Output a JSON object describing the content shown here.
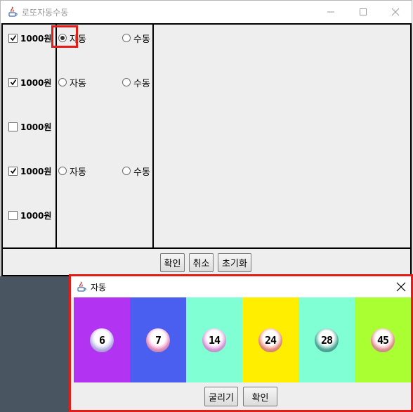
{
  "main_window": {
    "title": "로또자동수동",
    "rows": [
      {
        "checked": true,
        "amount": "1000원",
        "auto_label": "자동",
        "manual_label": "수동",
        "show_radios": true,
        "auto_selected": true
      },
      {
        "checked": true,
        "amount": "1000원",
        "auto_label": "자동",
        "manual_label": "수동",
        "show_radios": true,
        "auto_selected": false
      },
      {
        "checked": false,
        "amount": "1000원",
        "auto_label": "",
        "manual_label": "",
        "show_radios": false,
        "auto_selected": false
      },
      {
        "checked": true,
        "amount": "1000원",
        "auto_label": "자동",
        "manual_label": "수동",
        "show_radios": true,
        "auto_selected": false
      },
      {
        "checked": false,
        "amount": "1000원",
        "auto_label": "",
        "manual_label": "",
        "show_radios": false,
        "auto_selected": false
      }
    ],
    "buttons": {
      "confirm": "확인",
      "cancel": "취소",
      "reset": "초기화"
    }
  },
  "popup": {
    "title": "자동",
    "balls": [
      {
        "number": "6",
        "cell_color": "#b233f2",
        "ball_color": "#c8c0f8"
      },
      {
        "number": "7",
        "cell_color": "#4a5ff0",
        "ball_color": "#f4a0d0"
      },
      {
        "number": "14",
        "cell_color": "#80ffd4",
        "ball_color": "#e8a8e8"
      },
      {
        "number": "24",
        "cell_color": "#ffee00",
        "ball_color": "#f49a8a"
      },
      {
        "number": "28",
        "cell_color": "#80ffd4",
        "ball_color": "#5ab8a8"
      },
      {
        "number": "45",
        "cell_color": "#aaff33",
        "ball_color": "#f0a0a0"
      }
    ],
    "buttons": {
      "roll": "굴리기",
      "confirm": "확인"
    }
  }
}
